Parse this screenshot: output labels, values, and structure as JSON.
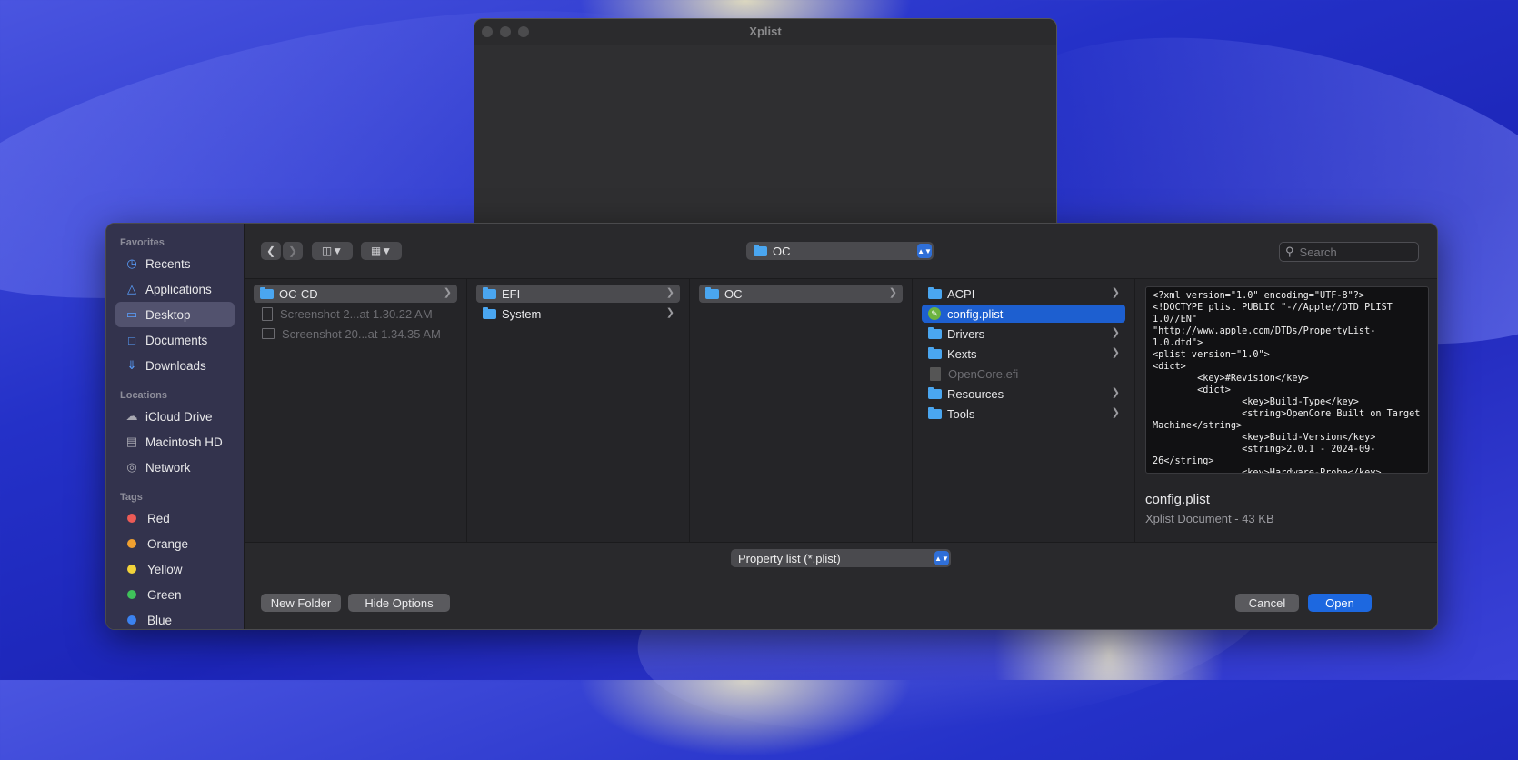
{
  "app_window": {
    "title": "Xplist"
  },
  "sidebar": {
    "favorites_header": "Favorites",
    "favorites": [
      {
        "label": "Recents",
        "icon": "clock-icon"
      },
      {
        "label": "Applications",
        "icon": "applications-icon"
      },
      {
        "label": "Desktop",
        "icon": "desktop-icon",
        "selected": true
      },
      {
        "label": "Documents",
        "icon": "document-icon"
      },
      {
        "label": "Downloads",
        "icon": "download-icon"
      }
    ],
    "locations_header": "Locations",
    "locations": [
      {
        "label": "iCloud Drive",
        "icon": "cloud-icon"
      },
      {
        "label": "Macintosh HD",
        "icon": "disk-icon"
      },
      {
        "label": "Network",
        "icon": "network-icon"
      }
    ],
    "tags_header": "Tags",
    "tags": [
      {
        "label": "Red",
        "color": "#ec5b56"
      },
      {
        "label": "Orange",
        "color": "#f0a030"
      },
      {
        "label": "Yellow",
        "color": "#f2d33a"
      },
      {
        "label": "Green",
        "color": "#3fc15a"
      },
      {
        "label": "Blue",
        "color": "#3b82f0"
      }
    ]
  },
  "toolbar": {
    "path_popup": "OC",
    "search_placeholder": "Search"
  },
  "columns": [
    {
      "items": [
        {
          "label": "OC-CD",
          "type": "folder",
          "state": "selected-gray",
          "chevron": true
        },
        {
          "label": "Screenshot 2...at 1.30.22 AM",
          "type": "doc",
          "state": "dim"
        },
        {
          "label": "Screenshot 20...at 1.34.35 AM",
          "type": "image",
          "state": "dim"
        }
      ]
    },
    {
      "items": [
        {
          "label": "EFI",
          "type": "folder",
          "state": "selected-gray",
          "chevron": true
        },
        {
          "label": "System",
          "type": "folder",
          "chevron": true
        }
      ]
    },
    {
      "items": [
        {
          "label": "OC",
          "type": "folder",
          "state": "selected-gray",
          "chevron": true
        }
      ]
    },
    {
      "items": [
        {
          "label": "ACPI",
          "type": "folder",
          "chevron": true
        },
        {
          "label": "config.plist",
          "type": "plist",
          "state": "selected-blue"
        },
        {
          "label": "Drivers",
          "type": "folder",
          "chevron": true
        },
        {
          "label": "Kexts",
          "type": "folder",
          "chevron": true
        },
        {
          "label": "OpenCore.efi",
          "type": "doc",
          "state": "dim"
        },
        {
          "label": "Resources",
          "type": "folder",
          "chevron": true
        },
        {
          "label": "Tools",
          "type": "folder",
          "chevron": true
        }
      ]
    }
  ],
  "preview": {
    "content": "<?xml version=\"1.0\" encoding=\"UTF-8\"?>\n<!DOCTYPE plist PUBLIC \"-//Apple//DTD PLIST 1.0//EN\" \"http://www.apple.com/DTDs/PropertyList-1.0.dtd\">\n<plist version=\"1.0\">\n<dict>\n        <key>#Revision</key>\n        <dict>\n                <key>Build-Type</key>\n                <string>OpenCore Built on Target Machine</string>\n                <key>Build-Version</key>\n                <string>2.0.1 - 2024-09-26</string>\n                <key>Hardware-Probe</key>\n                <data>",
    "name": "config.plist",
    "kind": "Xplist Document - 43 KB"
  },
  "format_popup": "Property list (*.plist)",
  "buttons": {
    "new_folder": "New Folder",
    "hide_options": "Hide Options",
    "cancel": "Cancel",
    "open": "Open"
  }
}
